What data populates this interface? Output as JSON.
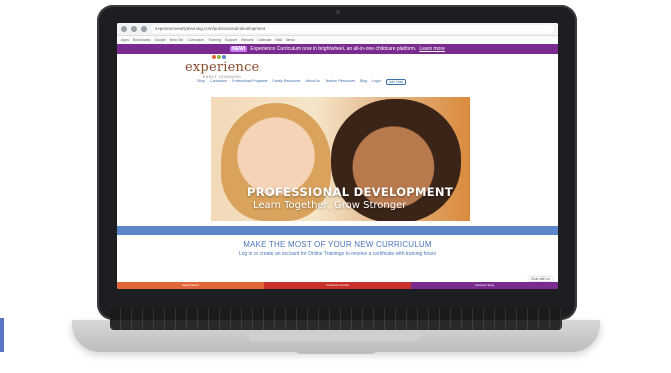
{
  "browser": {
    "url": "experienceearlylearning.com/professional-development"
  },
  "bookmarks": [
    "Apps",
    "Bookmarks",
    "Google",
    "New Tab",
    "Curriculum",
    "Training",
    "Support",
    "Reports",
    "Calendar",
    "Mail",
    "News"
  ],
  "announcement": {
    "badge": "NEW!",
    "text": "Experience Curriculum now in brightwheel, an all-in-one childcare platform.",
    "link": "Learn more"
  },
  "logo": {
    "name": "experience",
    "tagline": "EARLY LEARNING"
  },
  "menu": [
    "Shop",
    "Curriculum",
    "Professional Programs",
    "Family Resources",
    "About Us",
    "Teacher Resources",
    "Blog",
    "Login"
  ],
  "login_button": "Join Now",
  "hero": {
    "title": "PROFESSIONAL DEVELOPMENT",
    "subtitle": "Learn Together, Grow Stronger"
  },
  "section": {
    "title": "MAKE THE MOST OF YOUR NEW CURRICULUM",
    "subtitle": "Log in or create an account for Online Trainings to receive a certificate with training hours"
  },
  "cards": [
    "Getting Started",
    "Curriculum Overview",
    "Classroom Setup"
  ],
  "chat_label": "Chat with us",
  "colors": {
    "accent": "#5a77c7",
    "announcement": "#7b2b8f",
    "band": "#5d86c8",
    "card_orange": "#e1673a",
    "card_red": "#c9302c",
    "card_purple": "#7b2b8f"
  }
}
